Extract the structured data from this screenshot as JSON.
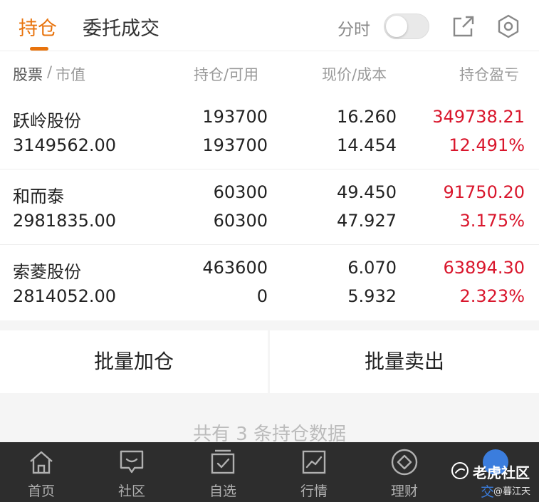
{
  "header": {
    "tabs": [
      {
        "label": "持仓",
        "active": true
      },
      {
        "label": "委托成交",
        "active": false
      }
    ],
    "intraday_label": "分时",
    "intraday_toggle": false
  },
  "columns": {
    "stock": "股票",
    "separator": "/",
    "market_value": "市值",
    "qty": "持仓/可用",
    "price": "现价/成本",
    "pnl": "持仓盈亏"
  },
  "holdings": [
    {
      "name": "跃岭股份",
      "market_value": "3149562.00",
      "position": "193700",
      "available": "193700",
      "price": "16.260",
      "cost": "14.454",
      "pnl": "349738.21",
      "pnl_pct": "12.491%"
    },
    {
      "name": "和而泰",
      "market_value": "2981835.00",
      "position": "60300",
      "available": "60300",
      "price": "49.450",
      "cost": "47.927",
      "pnl": "91750.20",
      "pnl_pct": "3.175%"
    },
    {
      "name": "索菱股份",
      "market_value": "2814052.00",
      "position": "463600",
      "available": "0",
      "price": "6.070",
      "cost": "5.932",
      "pnl": "63894.30",
      "pnl_pct": "2.323%"
    }
  ],
  "actions": {
    "batch_add": "批量加仓",
    "batch_sell": "批量卖出"
  },
  "summary": "共有 3 条持仓数据",
  "bottom_nav": [
    {
      "label": "首页",
      "icon": "home-icon"
    },
    {
      "label": "社区",
      "icon": "chat-icon"
    },
    {
      "label": "自选",
      "icon": "watchlist-icon"
    },
    {
      "label": "行情",
      "icon": "chart-icon"
    },
    {
      "label": "理财",
      "icon": "diamond-icon"
    },
    {
      "label": "交",
      "icon": "trade-icon"
    }
  ],
  "watermark": {
    "brand": "老虎社区",
    "user": "@暮江天"
  },
  "colors": {
    "accent": "#e8730c",
    "profit": "#d9162c",
    "nav_bg": "#2d2d2d",
    "badge": "#3b7ddd"
  }
}
